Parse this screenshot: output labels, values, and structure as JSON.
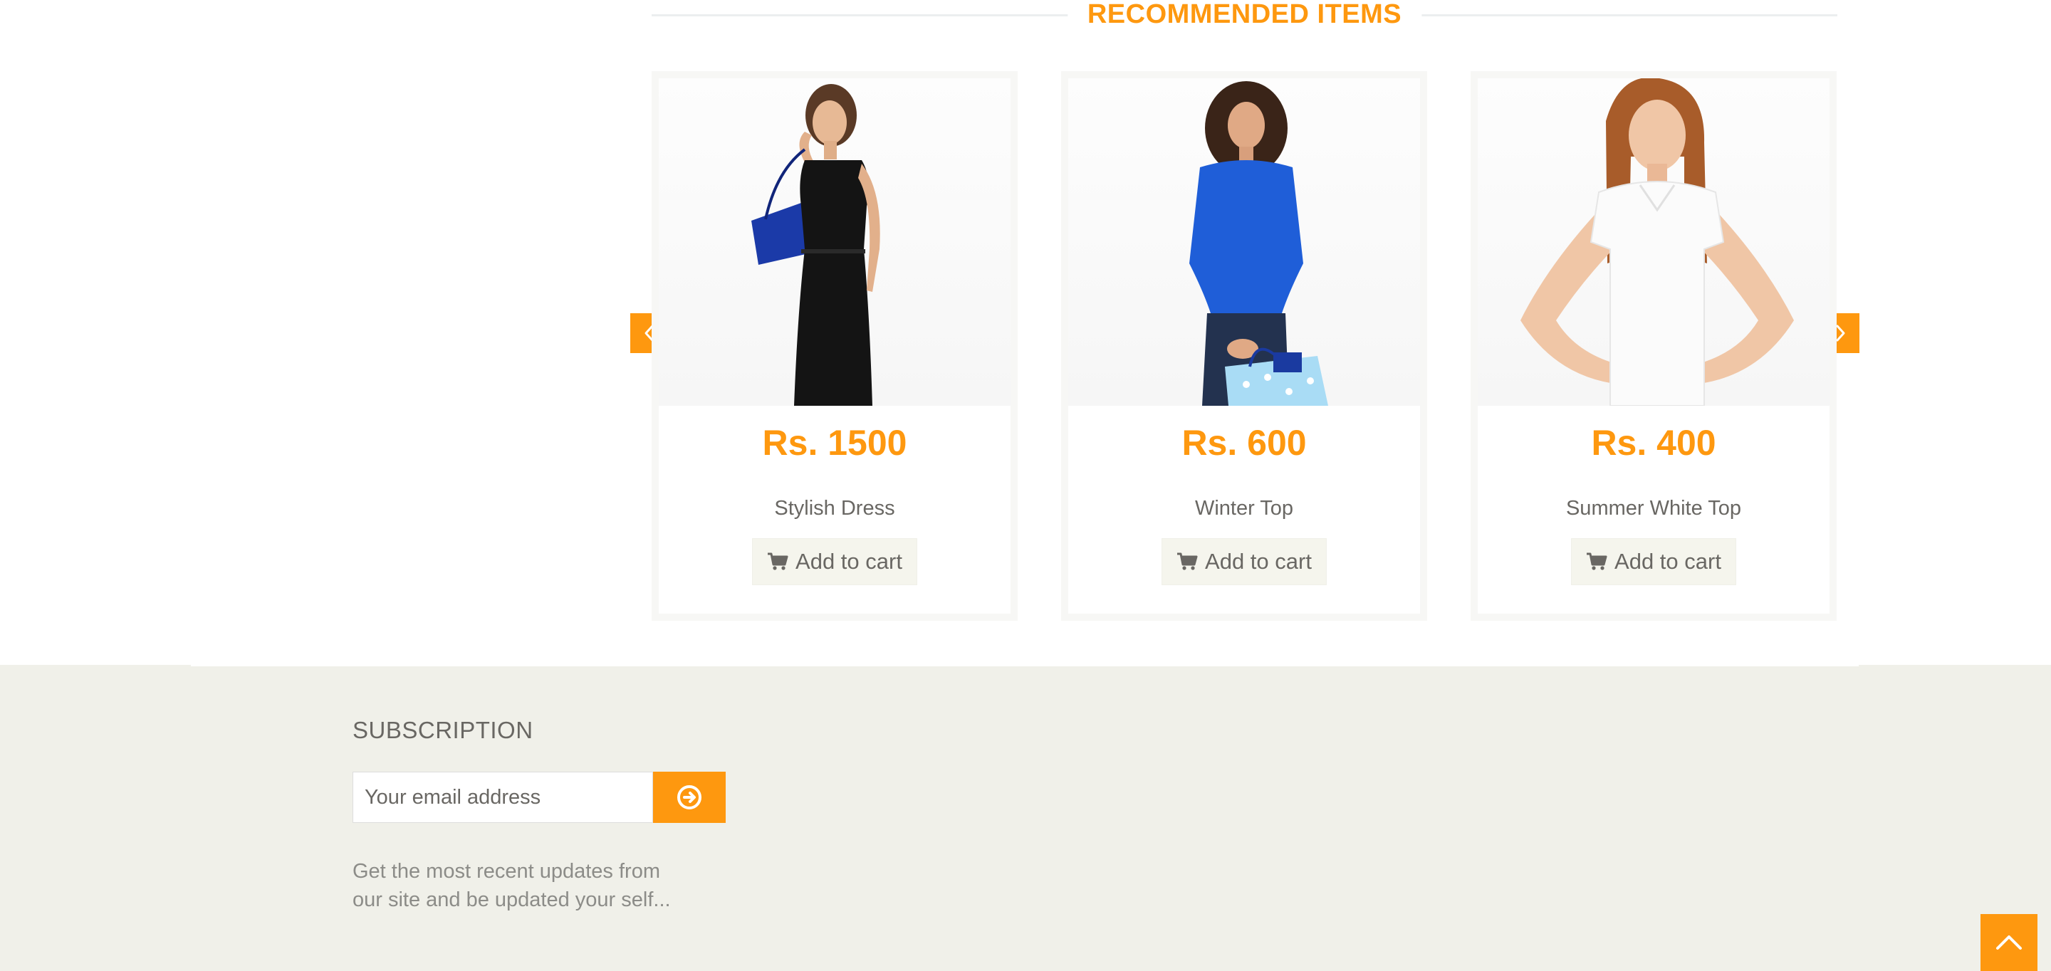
{
  "recommended": {
    "title": "RECOMMENDED ITEMS",
    "items": [
      {
        "price": "Rs. 1500",
        "name": "Stylish Dress",
        "cart_label": "Add to cart",
        "image": "woman-black-dress-with-bag"
      },
      {
        "price": "Rs. 600",
        "name": "Winter Top",
        "cart_label": "Add to cart",
        "image": "woman-blue-top-with-bag"
      },
      {
        "price": "Rs. 400",
        "name": "Summer White Top",
        "cart_label": "Add to cart",
        "image": "woman-white-tshirt"
      }
    ],
    "prev_icon": "chevron-left-icon",
    "next_icon": "chevron-right-icon"
  },
  "footer": {
    "subscription_title": "SUBSCRIPTION",
    "email_placeholder": "Your email address",
    "subscribe_icon": "arrow-circle-right-icon",
    "description": "Get the most recent updates from our site and be updated your self...",
    "scroll_top_icon": "chevron-up-icon"
  },
  "colors": {
    "accent": "#fe980f",
    "footer_bg": "#f0f0e9",
    "text": "#696763",
    "button_bg": "#f5f5ed"
  }
}
